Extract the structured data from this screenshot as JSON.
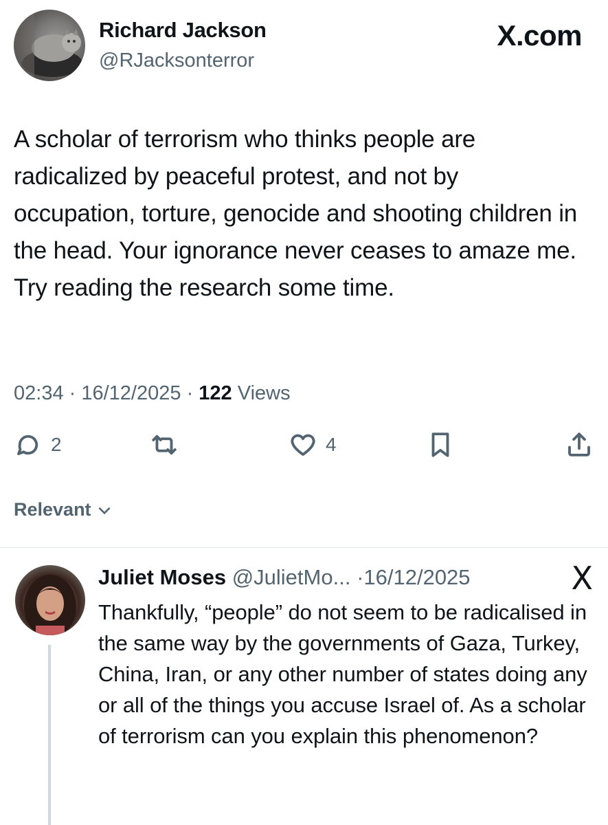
{
  "tweet": {
    "author_name": "Richard Jackson",
    "author_handle": "@RJacksonterror",
    "brand": "X.com",
    "text": "A scholar of terrorism who thinks people are radicalized by peaceful protest, and not by occupation, torture, genocide and shooting children in the head. Your ignorance never ceases to amaze me. Try reading the research some time.",
    "time": "02:34",
    "date": "16/12/2025",
    "views_count": "122",
    "views_label": "Views",
    "reply_count": "2",
    "like_count": "4"
  },
  "sort": {
    "label": "Relevant"
  },
  "reply": {
    "author_name": "Juliet Moses",
    "author_handle": "@JulietMo...",
    "date": "16/12/2025",
    "brand_icon": "X",
    "text": "Thankfully, “people” do not seem to be radicalised in the same way by the governments of Gaza, Turkey, China, Iran, or any other number of states doing any or all of the things you accuse Israel of. As a scholar of terrorism can you explain this phenomenon?"
  },
  "icons": {
    "reply": "reply-icon",
    "repost": "repost-icon",
    "like": "heart-icon",
    "bookmark": "bookmark-icon",
    "share": "share-icon",
    "chevron": "chevron-down-icon"
  }
}
